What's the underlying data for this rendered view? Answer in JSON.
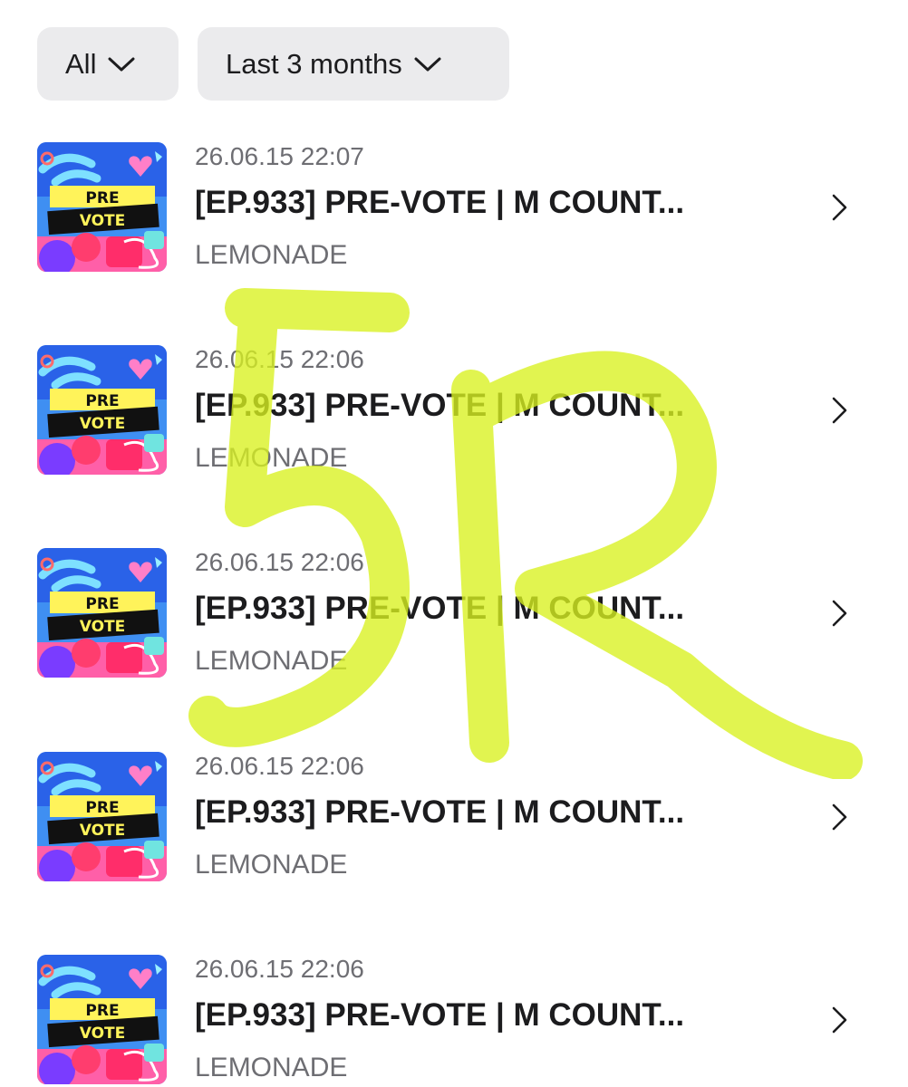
{
  "filters": {
    "type_label": "All",
    "period_label": "Last 3 months"
  },
  "thumbnail": {
    "line1": "PRE",
    "line2": "VOTE"
  },
  "history": [
    {
      "date": "26.06.15 22:07",
      "title": "[EP.933] PRE-VOTE | M COUNT...",
      "artist": "LEMONADE"
    },
    {
      "date": "26.06.15 22:06",
      "title": "[EP.933] PRE-VOTE | M COUNT...",
      "artist": "LEMONADE"
    },
    {
      "date": "26.06.15 22:06",
      "title": "[EP.933] PRE-VOTE | M COUNT...",
      "artist": "LEMONADE"
    },
    {
      "date": "26.06.15 22:06",
      "title": "[EP.933] PRE-VOTE | M COUNT...",
      "artist": "LEMONADE"
    },
    {
      "date": "26.06.15 22:06",
      "title": "[EP.933] PRE-VOTE | M COUNT...",
      "artist": "LEMONADE"
    }
  ],
  "watermark": {
    "text": "5R",
    "color": "#d9f220"
  },
  "colors": {
    "filter_bg": "#ebebed",
    "text_primary": "#1c1c1e",
    "text_secondary": "#6e6e73"
  }
}
